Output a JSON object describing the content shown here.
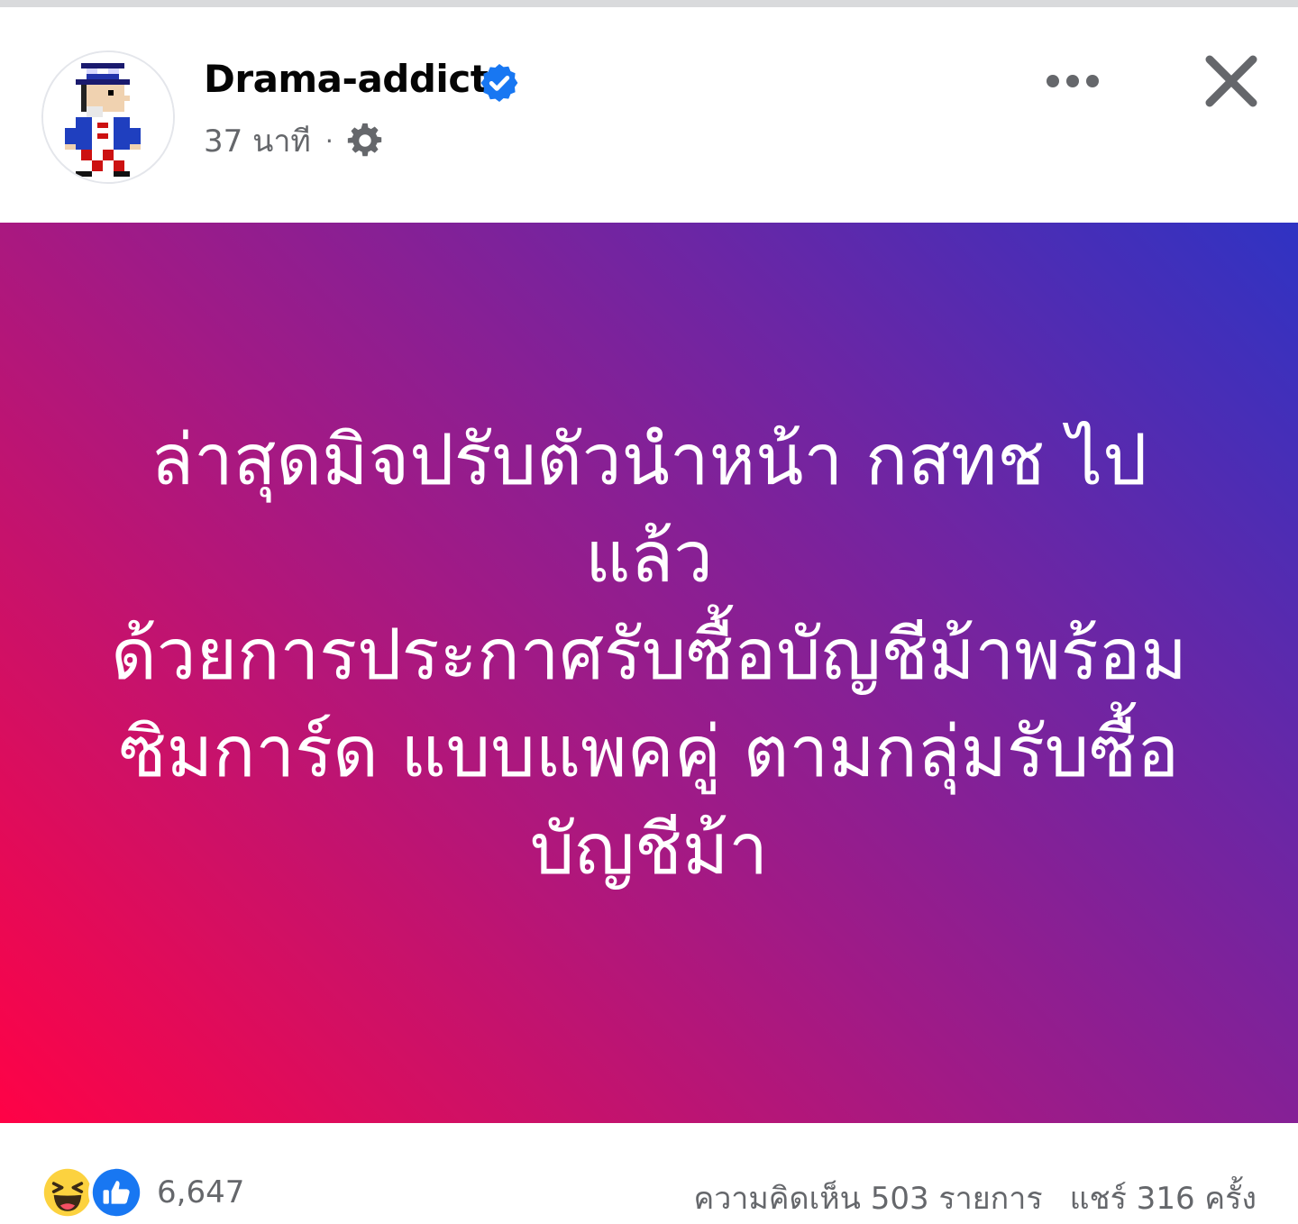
{
  "header": {
    "author_name": "Drama-addict",
    "timestamp": "37 นาที",
    "separator": "·",
    "icons": {
      "avatar": "pixel-art-uncle-sam-avatar",
      "verified": "verified-badge-icon",
      "privacy": "gear-icon",
      "more": "more-options-icon",
      "close": "close-icon"
    }
  },
  "post": {
    "text": "ล่าสุดมิจปรับตัวนำหน้า กสทช ไป\nแล้ว\nด้วยการประกาศรับซื้อบัญชีม้าพร้อม\nซิมการ์ด แบบแพคคู่ ตามกลุ่มรับซื้อ\nบัญชีม้า",
    "background_gradient": [
      "#2f33c3",
      "#6b26a5",
      "#a11a86",
      "#d40f62",
      "#ff0246"
    ],
    "text_color": "#ffffff"
  },
  "footer": {
    "reaction_icons": [
      "haha-icon",
      "like-icon"
    ],
    "reaction_count": "6,647",
    "comments": "ความคิดเห็น 503 รายการ",
    "shares": "แชร์ 316 ครั้ง"
  },
  "colors": {
    "accent_blue": "#1877f2",
    "secondary_text": "#65676b",
    "primary_text": "#050505"
  }
}
